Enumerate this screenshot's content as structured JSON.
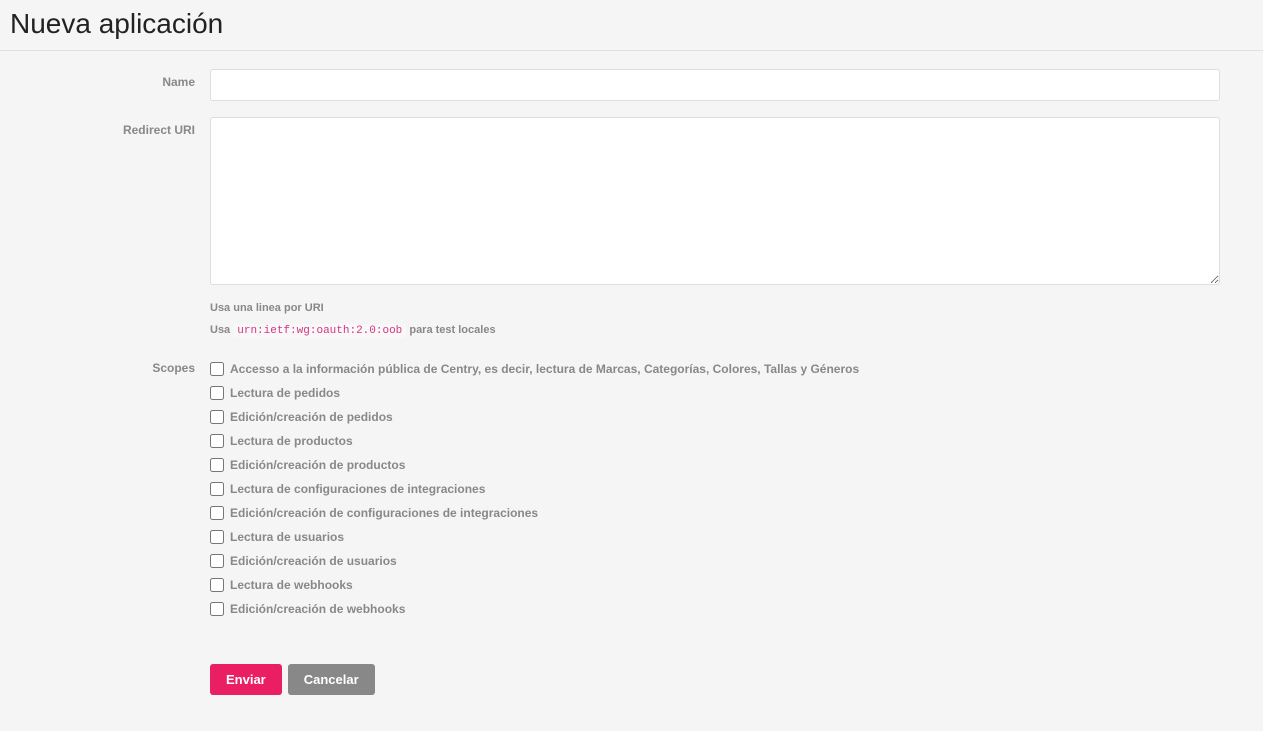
{
  "header": {
    "title": "Nueva aplicación"
  },
  "form": {
    "name": {
      "label": "Name",
      "value": ""
    },
    "redirect_uri": {
      "label": "Redirect URI",
      "value": "",
      "help_line1": "Usa una linea por URI",
      "help_line2_prefix": "Usa ",
      "help_line2_code": "urn:ietf:wg:oauth:2.0:oob",
      "help_line2_suffix": " para test locales"
    },
    "scopes": {
      "label": "Scopes",
      "items": [
        "Accesso a la información pública de Centry, es decir, lectura de Marcas, Categorías, Colores, Tallas y Géneros",
        "Lectura de pedidos",
        "Edición/creación de pedidos",
        "Lectura de productos",
        "Edición/creación de productos",
        "Lectura de configuraciones de integraciones",
        "Edición/creación de configuraciones de integraciones",
        "Lectura de usuarios",
        "Edición/creación de usuarios",
        "Lectura de webhooks",
        "Edición/creación de webhooks"
      ]
    },
    "buttons": {
      "submit": "Enviar",
      "cancel": "Cancelar"
    }
  }
}
